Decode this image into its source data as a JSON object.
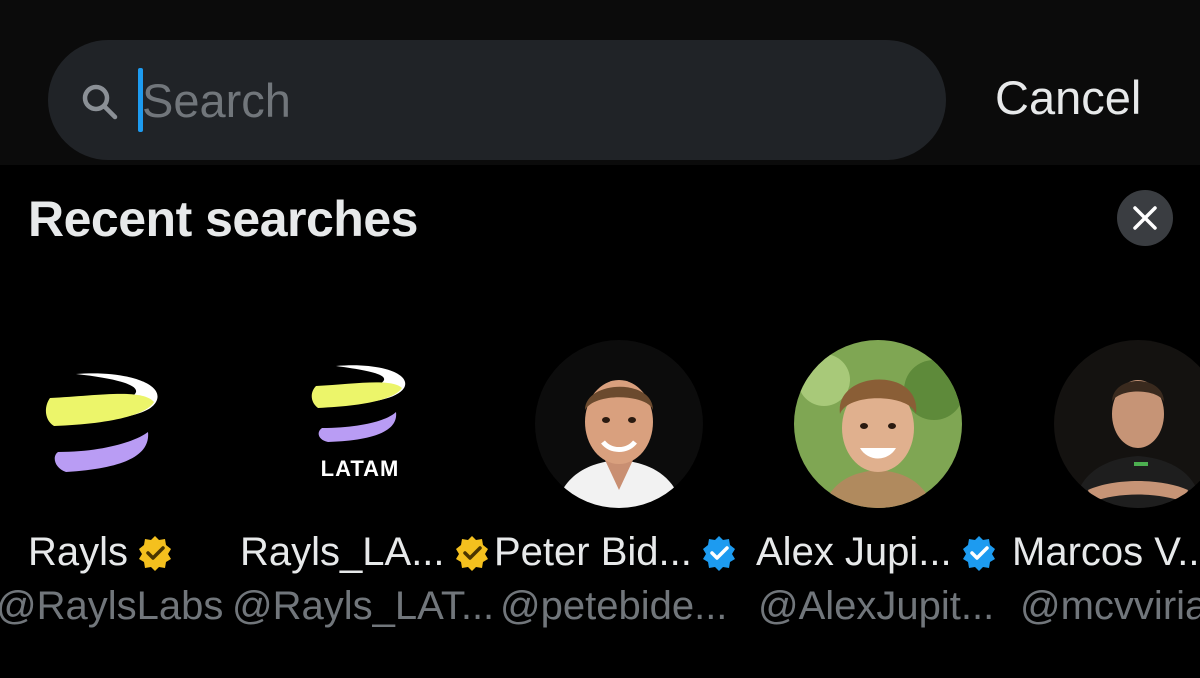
{
  "search": {
    "placeholder": "Search",
    "cancel_label": "Cancel"
  },
  "recent": {
    "title": "Recent searches",
    "items": [
      {
        "name": "Rayls",
        "handle": "@RaylsLabs",
        "badge": "gold-check",
        "avatar": "rayls-logo-icon"
      },
      {
        "name": "Rayls_LA...",
        "handle": "@Rayls_LAT...",
        "badge": "gold-check",
        "avatar": "rayls-latam-logo-icon",
        "avatar_text": "LATAM"
      },
      {
        "name": "Peter Bid...",
        "handle": "@petebide...",
        "badge": "blue-check",
        "avatar": "person-photo"
      },
      {
        "name": "Alex Jupi...",
        "handle": "@AlexJupit...",
        "badge": "blue-check",
        "avatar": "person-photo"
      },
      {
        "name": "Marcos V...",
        "handle": "@mcvviria",
        "badge": "none",
        "avatar": "person-photo"
      }
    ]
  },
  "colors": {
    "background": "#000000",
    "search_bg": "#202327",
    "accent_blue": "#1d9bf0",
    "gold_badge": "#f4c01e",
    "secondary_text": "#71767b"
  }
}
